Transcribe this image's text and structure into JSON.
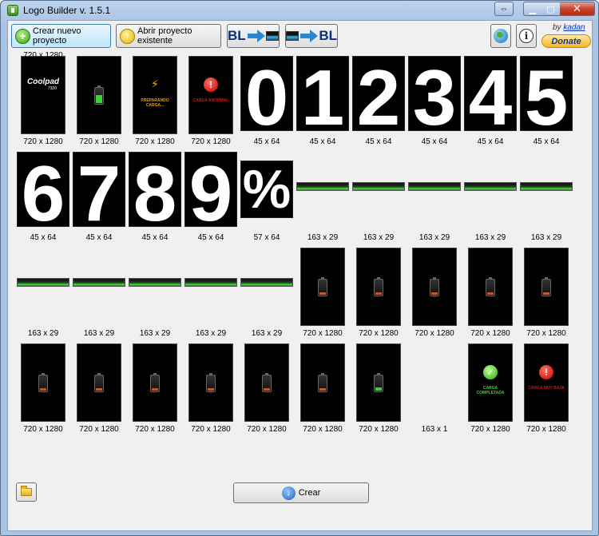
{
  "window": {
    "title": "Logo Builder v. 1.5.1"
  },
  "toolbar": {
    "new_project": "Crear nuevo proyecto",
    "open_project": "Abrir proyecto existente",
    "bl_left": "BL",
    "bl_right": "BL",
    "by": "by",
    "author": "kadan",
    "donate": "Donate"
  },
  "footer": {
    "create": "Crear"
  },
  "images": [
    {
      "kind": "coolpad",
      "size": "720 x 1280",
      "logo": "Coolpad",
      "model": "7320"
    },
    {
      "kind": "battery-charging",
      "size": "720 x 1280"
    },
    {
      "kind": "bolt",
      "size": "720 x 1280",
      "text": "PREPARANDO CARGA..."
    },
    {
      "kind": "error",
      "size": "720 x 1280",
      "text": "CARGA ANORMAL"
    },
    {
      "kind": "digit",
      "size": "45 x 64",
      "glyph": "0"
    },
    {
      "kind": "digit",
      "size": "45 x 64",
      "glyph": "1"
    },
    {
      "kind": "digit",
      "size": "45 x 64",
      "glyph": "2"
    },
    {
      "kind": "digit",
      "size": "45 x 64",
      "glyph": "3"
    },
    {
      "kind": "digit",
      "size": "45 x 64",
      "glyph": "4"
    },
    {
      "kind": "digit",
      "size": "45 x 64",
      "glyph": "5"
    },
    {
      "kind": "digit",
      "size": "45 x 64",
      "glyph": "6"
    },
    {
      "kind": "digit",
      "size": "45 x 64",
      "glyph": "7"
    },
    {
      "kind": "digit",
      "size": "45 x 64",
      "glyph": "8"
    },
    {
      "kind": "digit",
      "size": "45 x 64",
      "glyph": "9"
    },
    {
      "kind": "percent",
      "size": "57 x 64",
      "glyph": "%"
    },
    {
      "kind": "bar",
      "size": "163 x 29"
    },
    {
      "kind": "bar",
      "size": "163 x 29"
    },
    {
      "kind": "bar",
      "size": "163 x 29"
    },
    {
      "kind": "bar",
      "size": "163 x 29"
    },
    {
      "kind": "bar",
      "size": "163 x 29"
    },
    {
      "kind": "bar",
      "size": "163 x 29"
    },
    {
      "kind": "bar",
      "size": "163 x 29"
    },
    {
      "kind": "bar",
      "size": "163 x 29"
    },
    {
      "kind": "bar",
      "size": "163 x 29"
    },
    {
      "kind": "bar",
      "size": "163 x 29"
    },
    {
      "kind": "battery",
      "size": "720 x 1280"
    },
    {
      "kind": "battery",
      "size": "720 x 1280"
    },
    {
      "kind": "battery",
      "size": "720 x 1280"
    },
    {
      "kind": "battery",
      "size": "720 x 1280"
    },
    {
      "kind": "battery",
      "size": "720 x 1280"
    },
    {
      "kind": "battery",
      "size": "720 x 1280"
    },
    {
      "kind": "battery",
      "size": "720 x 1280"
    },
    {
      "kind": "battery",
      "size": "720 x 1280"
    },
    {
      "kind": "battery",
      "size": "720 x 1280"
    },
    {
      "kind": "battery",
      "size": "720 x 1280"
    },
    {
      "kind": "battery",
      "size": "720 x 1280"
    },
    {
      "kind": "battery-full",
      "size": "720 x 1280"
    },
    {
      "kind": "empty",
      "size": "163 x 1"
    },
    {
      "kind": "done",
      "size": "720 x 1280",
      "text": "CARGA COMPLETADA"
    },
    {
      "kind": "error",
      "size": "720 x 1280",
      "text": "CARGA MUY BAJA"
    },
    {
      "kind": "coolpad",
      "size": "720 x 1280",
      "logo": "Coolpad",
      "model": "7320"
    }
  ],
  "colors": {
    "accent": "#2a86d1",
    "bar_green": "#3fcf3a",
    "battery_orange": "#c45a23",
    "error_red": "#c30000"
  }
}
